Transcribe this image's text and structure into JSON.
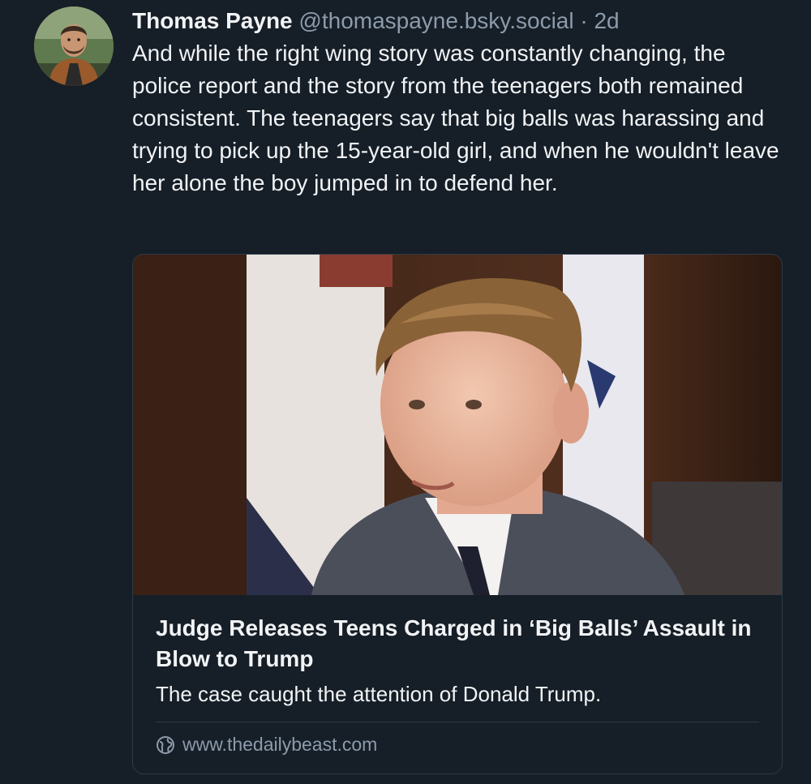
{
  "author": {
    "name": "Thomas Payne",
    "handle": "@thomaspayne.bsky.social",
    "separator": "·",
    "time": "2d"
  },
  "post": {
    "text": "And while the right wing story was constantly changing, the police report and the story from the teenagers both remained consistent. The teenagers say that big balls was harassing and trying to pick up the 15-year-old girl, and when he wouldn't leave her alone the boy jumped in to defend her."
  },
  "link_card": {
    "title": "Judge Releases Teens Charged in ‘Big Balls’ Assault in Blow to Trump",
    "description": "The case caught the attention of Donald Trump.",
    "source": "www.thedailybeast.com",
    "icon": "globe-icon"
  },
  "colors": {
    "background": "#161e27",
    "text": "#f1f3f5",
    "muted": "#8c9bab",
    "border": "#2e3b49"
  }
}
